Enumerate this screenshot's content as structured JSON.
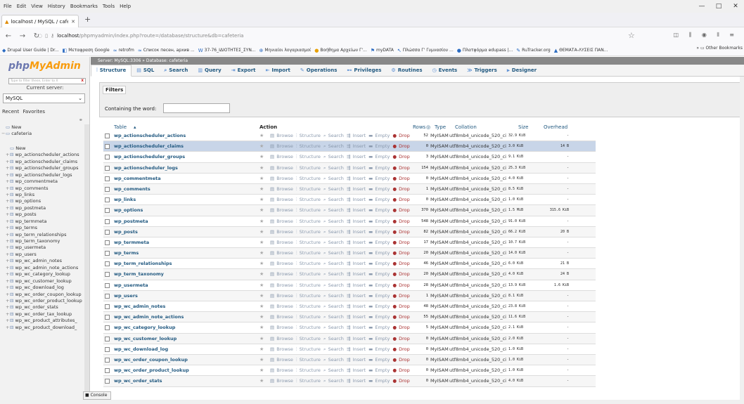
{
  "menu": [
    "File",
    "Edit",
    "View",
    "History",
    "Bookmarks",
    "Tools",
    "Help"
  ],
  "tab": {
    "title": "localhost / MySQL / cafeteria | ..."
  },
  "url": {
    "prefix": "localhost",
    "rest": "/phpmyadmin/index.php?route=/database/structure&db=cafeteria"
  },
  "bookmarks": [
    "Drupal User Guide | Dr...",
    "Μεταφραση Google",
    "retrofm",
    "Список песен, архив ...",
    "37-76_ΙΔΙΟΤΗΤΕΣ_ΣΥΝ...",
    "Μηνιαίοι λογαριασμοί",
    "Βοήθημα Αρχείων Γ'...",
    "myDATA",
    "Πλώσσα Γ' Γυμνασίου ...",
    "Πλατφόρμα edupass |...",
    "RuTracker.org",
    "ΘΕΜΑΤΑ-ΛΥΣΕΙΣ ΠΑΝ..."
  ],
  "other_bookmarks": "Other Bookmarks",
  "sidebar": {
    "logo_a": "php",
    "logo_b": "MyAdmin",
    "current_server": "Current server:",
    "server": "MySQL",
    "tabs": [
      "Recent",
      "Favorites"
    ],
    "filter_placeholder": "Type to filter these, Enter to X",
    "tree_root": "New",
    "db": "cafeteria",
    "new_table": "New",
    "tree": [
      "wp_actionscheduler_actions",
      "wp_actionscheduler_claims",
      "wp_actionscheduler_groups",
      "wp_actionscheduler_logs",
      "wp_commentmeta",
      "wp_comments",
      "wp_links",
      "wp_options",
      "wp_postmeta",
      "wp_posts",
      "wp_termmeta",
      "wp_terms",
      "wp_term_relationships",
      "wp_term_taxonomy",
      "wp_usermeta",
      "wp_users",
      "wp_wc_admin_notes",
      "wp_wc_admin_note_actions",
      "wp_wc_category_lookup",
      "wp_wc_customer_lookup",
      "wp_wc_download_log",
      "wp_wc_order_coupon_lookup",
      "wp_wc_order_product_lookup",
      "wp_wc_order_stats",
      "wp_wc_order_tax_lookup",
      "wp_wc_product_attributes_",
      "wp_wc_product_download_"
    ]
  },
  "breadcrumb": "Server: MySQL:3306 » Database: cafeteria",
  "db_tabs": [
    "Structure",
    "SQL",
    "Search",
    "Query",
    "Export",
    "Import",
    "Operations",
    "Privileges",
    "Routines",
    "Events",
    "Triggers",
    "Designer"
  ],
  "filters": {
    "legend": "Filters",
    "label": "Containing the word:"
  },
  "table_headers": {
    "table": "Table",
    "action": "Action",
    "rows": "Rows",
    "type": "Type",
    "collation": "Collation",
    "size": "Size",
    "overhead": "Overhead"
  },
  "actions": [
    "Browse",
    "Structure",
    "Search",
    "Insert",
    "Empty",
    "Drop"
  ],
  "rows": [
    {
      "name": "wp_actionscheduler_actions",
      "rows": "52",
      "type": "MyISAM",
      "collation": "utf8mb4_unicode_520_ci",
      "size": "32.9 KiB",
      "overhead": "-"
    },
    {
      "name": "wp_actionscheduler_claims",
      "rows": "0",
      "type": "MyISAM",
      "collation": "utf8mb4_unicode_520_ci",
      "size": "3.0 KiB",
      "overhead": "14 B"
    },
    {
      "name": "wp_actionscheduler_groups",
      "rows": "3",
      "type": "MyISAM",
      "collation": "utf8mb4_unicode_520_ci",
      "size": "9.1 KiB",
      "overhead": "-"
    },
    {
      "name": "wp_actionscheduler_logs",
      "rows": "154",
      "type": "MyISAM",
      "collation": "utf8mb4_unicode_520_ci",
      "size": "25.3 KiB",
      "overhead": "-"
    },
    {
      "name": "wp_commentmeta",
      "rows": "0",
      "type": "MyISAM",
      "collation": "utf8mb4_unicode_520_ci",
      "size": "4.0 KiB",
      "overhead": "-"
    },
    {
      "name": "wp_comments",
      "rows": "1",
      "type": "MyISAM",
      "collation": "utf8mb4_unicode_520_ci",
      "size": "8.5 KiB",
      "overhead": "-"
    },
    {
      "name": "wp_links",
      "rows": "0",
      "type": "MyISAM",
      "collation": "utf8mb4_unicode_520_ci",
      "size": "1.0 KiB",
      "overhead": "-"
    },
    {
      "name": "wp_options",
      "rows": "370",
      "type": "MyISAM",
      "collation": "utf8mb4_unicode_520_ci",
      "size": "1.5 MiB",
      "overhead": "315.6 KiB"
    },
    {
      "name": "wp_postmeta",
      "rows": "548",
      "type": "MyISAM",
      "collation": "utf8mb4_unicode_520_ci",
      "size": "91.0 KiB",
      "overhead": "-"
    },
    {
      "name": "wp_posts",
      "rows": "82",
      "type": "MyISAM",
      "collation": "utf8mb4_unicode_520_ci",
      "size": "66.2 KiB",
      "overhead": "20 B"
    },
    {
      "name": "wp_termmeta",
      "rows": "17",
      "type": "MyISAM",
      "collation": "utf8mb4_unicode_520_ci",
      "size": "10.7 KiB",
      "overhead": "-"
    },
    {
      "name": "wp_terms",
      "rows": "20",
      "type": "MyISAM",
      "collation": "utf8mb4_unicode_520_ci",
      "size": "14.0 KiB",
      "overhead": "-"
    },
    {
      "name": "wp_term_relationships",
      "rows": "46",
      "type": "MyISAM",
      "collation": "utf8mb4_unicode_520_ci",
      "size": "6.0 KiB",
      "overhead": "21 B"
    },
    {
      "name": "wp_term_taxonomy",
      "rows": "20",
      "type": "MyISAM",
      "collation": "utf8mb4_unicode_520_ci",
      "size": "4.0 KiB",
      "overhead": "24 B"
    },
    {
      "name": "wp_usermeta",
      "rows": "28",
      "type": "MyISAM",
      "collation": "utf8mb4_unicode_520_ci",
      "size": "13.9 KiB",
      "overhead": "1.6 KiB"
    },
    {
      "name": "wp_users",
      "rows": "1",
      "type": "MyISAM",
      "collation": "utf8mb4_unicode_520_ci",
      "size": "8.1 KiB",
      "overhead": "-"
    },
    {
      "name": "wp_wc_admin_notes",
      "rows": "48",
      "type": "MyISAM",
      "collation": "utf8mb4_unicode_520_ci",
      "size": "23.8 KiB",
      "overhead": "-"
    },
    {
      "name": "wp_wc_admin_note_actions",
      "rows": "55",
      "type": "MyISAM",
      "collation": "utf8mb4_unicode_520_ci",
      "size": "11.6 KiB",
      "overhead": "-"
    },
    {
      "name": "wp_wc_category_lookup",
      "rows": "5",
      "type": "MyISAM",
      "collation": "utf8mb4_unicode_520_ci",
      "size": "2.1 KiB",
      "overhead": "-"
    },
    {
      "name": "wp_wc_customer_lookup",
      "rows": "0",
      "type": "MyISAM",
      "collation": "utf8mb4_unicode_520_ci",
      "size": "2.0 KiB",
      "overhead": "-"
    },
    {
      "name": "wp_wc_download_log",
      "rows": "0",
      "type": "MyISAM",
      "collation": "utf8mb4_unicode_520_ci",
      "size": "1.0 KiB",
      "overhead": "-"
    },
    {
      "name": "wp_wc_order_coupon_lookup",
      "rows": "0",
      "type": "MyISAM",
      "collation": "utf8mb4_unicode_520_ci",
      "size": "1.0 KiB",
      "overhead": "-"
    },
    {
      "name": "wp_wc_order_product_lookup",
      "rows": "0",
      "type": "MyISAM",
      "collation": "utf8mb4_unicode_520_ci",
      "size": "1.0 KiB",
      "overhead": "-"
    },
    {
      "name": "wp_wc_order_stats",
      "rows": "0",
      "type": "MyISAM",
      "collation": "utf8mb4_unicode_520_ci",
      "size": "4.0 KiB",
      "overhead": "-"
    }
  ],
  "console_label": "Console"
}
